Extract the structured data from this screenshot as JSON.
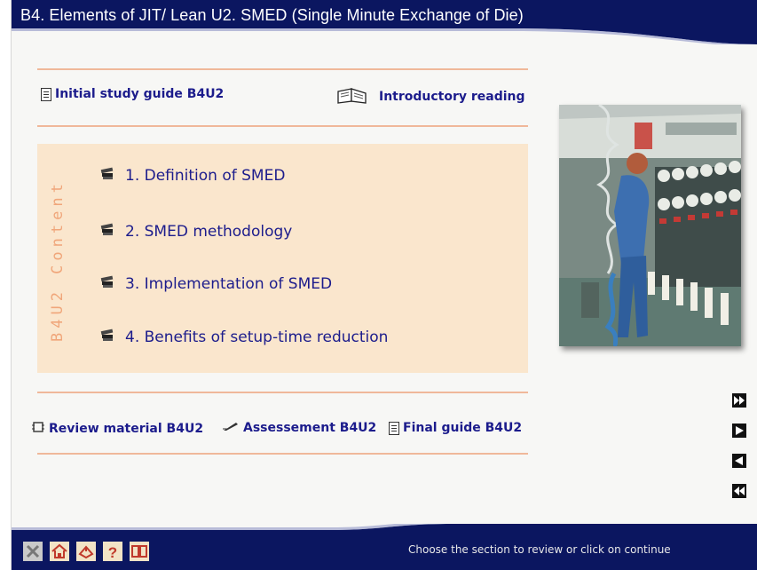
{
  "header": {
    "title": "B4. Elements of JIT/ Lean  U2. SMED (Single Minute Exchange of Die)"
  },
  "top_links": {
    "study_guide": "Initial study guide B4U2",
    "intro_reading": "Introductory reading"
  },
  "content": {
    "section_label": "B4U2 Content",
    "topics": [
      "1. Definition of SMED",
      "2. SMED methodology",
      "3. Implementation of SMED",
      "4. Benefits of setup-time reduction"
    ]
  },
  "bottom_links": {
    "review": "Review material B4U2",
    "assessment": "Assessement B4U2",
    "final_guide": "Final guide B4U2"
  },
  "status": "Choose the section to review or click on continue",
  "icons": {
    "nav": [
      "fast-forward-icon",
      "play-forward-icon",
      "play-back-icon",
      "rewind-icon"
    ],
    "toolbar": [
      "close-icon",
      "home-icon",
      "map-icon",
      "help-icon",
      "glossary-book-icon"
    ]
  },
  "colors": {
    "navy": "#0b1660",
    "link": "#1c1c8c",
    "accent": "#f0b89a",
    "panel": "#fae6cd"
  }
}
